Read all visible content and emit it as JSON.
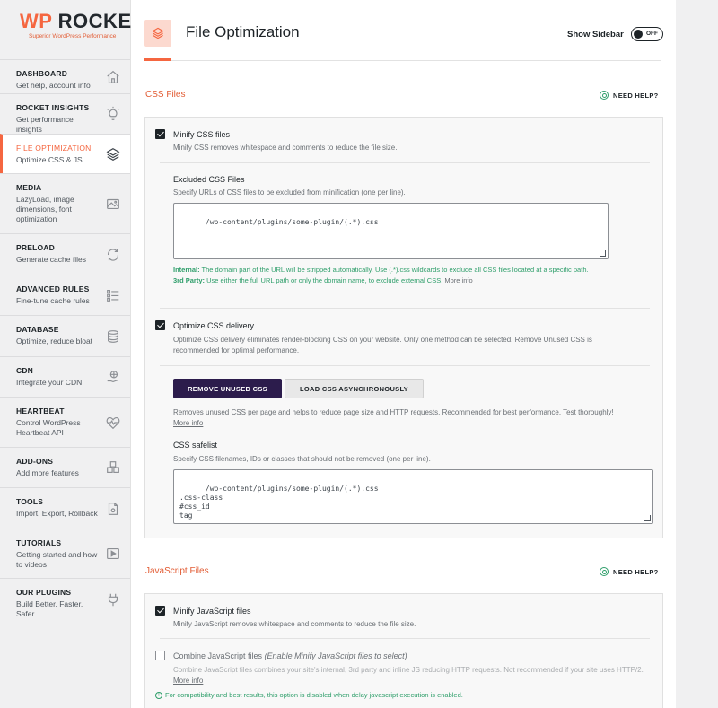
{
  "brand": {
    "wp": "WP",
    "rocket": "ROCKET",
    "tagline": "Superior WordPress Performance"
  },
  "sidebar": {
    "items": [
      {
        "title": "DASHBOARD",
        "sub": "Get help, account info"
      },
      {
        "title": "ROCKET INSIGHTS",
        "sub": "Get performance insights"
      },
      {
        "title": "FILE OPTIMIZATION",
        "sub": "Optimize CSS & JS"
      },
      {
        "title": "MEDIA",
        "sub": "LazyLoad, image dimensions, font optimization"
      },
      {
        "title": "PRELOAD",
        "sub": "Generate cache files"
      },
      {
        "title": "ADVANCED RULES",
        "sub": "Fine-tune cache rules"
      },
      {
        "title": "DATABASE",
        "sub": "Optimize, reduce bloat"
      },
      {
        "title": "CDN",
        "sub": "Integrate your CDN"
      },
      {
        "title": "HEARTBEAT",
        "sub": "Control WordPress Heartbeat API"
      },
      {
        "title": "ADD-ONS",
        "sub": "Add more features"
      },
      {
        "title": "TOOLS",
        "sub": "Import, Export, Rollback"
      },
      {
        "title": "TUTORIALS",
        "sub": "Getting started and how to videos"
      },
      {
        "title": "OUR PLUGINS",
        "sub": "Build Better, Faster, Safer"
      }
    ]
  },
  "header": {
    "title": "File Optimization",
    "show_sidebar": "Show Sidebar",
    "toggle": "OFF"
  },
  "css_section": {
    "title": "CSS Files",
    "need_help": "NEED HELP?",
    "minify": {
      "label": "Minify CSS files",
      "desc": "Minify CSS removes whitespace and comments to reduce the file size.",
      "checked": true
    },
    "excluded": {
      "label": "Excluded CSS Files",
      "desc": "Specify URLs of CSS files to be excluded from minification (one per line).",
      "value": "/wp-content/plugins/some-plugin/(.*).css",
      "note_internal_label": "Internal:",
      "note_internal": " The domain part of the URL will be stripped automatically. Use (.*).css wildcards to exclude all CSS files located at a specific path.",
      "note_3rd_label": "3rd Party:",
      "note_3rd": " Use either the full URL path or only the domain name, to exclude external CSS. ",
      "more_info": "More info"
    },
    "optimize_delivery": {
      "label": "Optimize CSS delivery",
      "desc": "Optimize CSS delivery eliminates render-blocking CSS on your website. Only one method can be selected. Remove Unused CSS is recommended for optimal performance.",
      "checked": true
    },
    "buttons": {
      "remove_unused": "REMOVE UNUSED CSS",
      "load_async": "LOAD CSS ASYNCHRONOUSLY"
    },
    "remove_desc": "Removes unused CSS per page and helps to reduce page size and HTTP requests. Recommended for best performance. Test thoroughly!",
    "remove_more": "More info",
    "safelist": {
      "label": "CSS safelist",
      "desc": "Specify CSS filenames, IDs or classes that should not be removed (one per line).",
      "value": "/wp-content/plugins/some-plugin/(.*).css\n.css-class\n#css_id\ntag"
    }
  },
  "js_section": {
    "title": "JavaScript Files",
    "need_help": "NEED HELP?",
    "minify": {
      "label": "Minify JavaScript files",
      "desc": "Minify JavaScript removes whitespace and comments to reduce the file size.",
      "checked": true
    },
    "combine": {
      "label": "Combine JavaScript files ",
      "label_em": "(Enable Minify JavaScript files to select)",
      "desc": "Combine JavaScript files combines your site's internal, 3rd party and inline JS reducing HTTP requests. Not recommended if your site uses HTTP/2. ",
      "more": "More info",
      "checked": false
    },
    "compat_note": "For compatibility and best results, this option is disabled when delay javascript execution is enabled."
  },
  "colors": {
    "accent": "#f56640",
    "primary_button": "#2c1c4c",
    "note_green": "#2e9e6a"
  }
}
